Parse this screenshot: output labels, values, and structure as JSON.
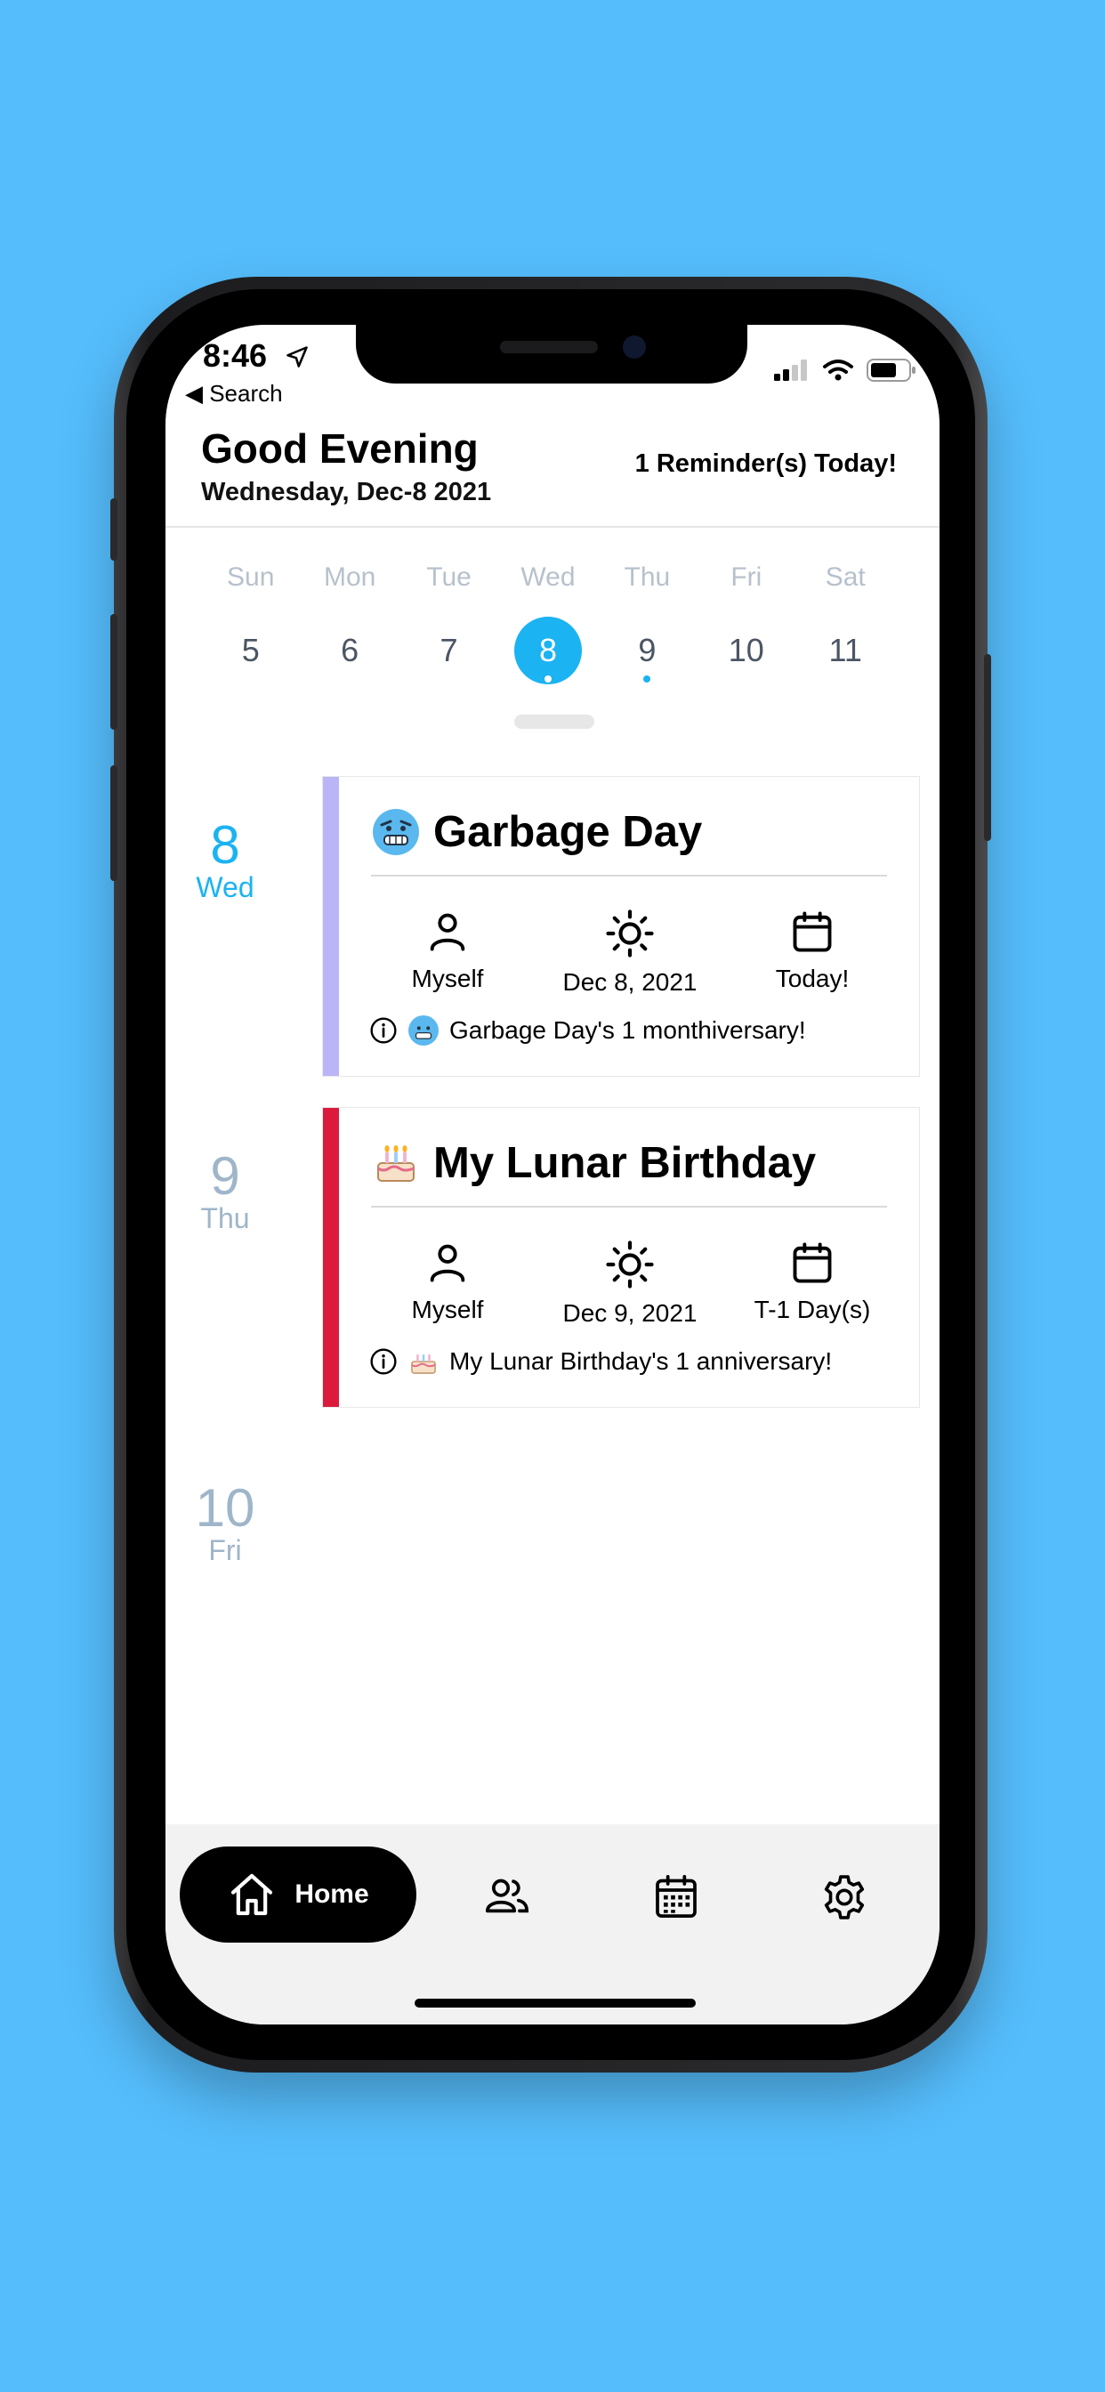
{
  "status_bar": {
    "time": "8:46",
    "back_label": "◀ Search"
  },
  "header": {
    "greeting": "Good Evening",
    "date": "Wednesday, Dec-8 2021",
    "reminder_count": "1 Reminder(s) Today!"
  },
  "week": {
    "days": [
      {
        "dow": "Sun",
        "num": "5"
      },
      {
        "dow": "Mon",
        "num": "6"
      },
      {
        "dow": "Tue",
        "num": "7"
      },
      {
        "dow": "Wed",
        "num": "8",
        "selected": true,
        "has_event": true
      },
      {
        "dow": "Thu",
        "num": "9",
        "has_event": true
      },
      {
        "dow": "Fri",
        "num": "10"
      },
      {
        "dow": "Sat",
        "num": "11"
      }
    ]
  },
  "timeline": [
    {
      "num": "8",
      "dow": "Wed",
      "color": "#1bb3f2"
    },
    {
      "num": "9",
      "dow": "Thu",
      "color": "#9fb5c9"
    },
    {
      "num": "10",
      "dow": "Fri",
      "color": "#9fb5c9"
    }
  ],
  "events": [
    {
      "title": "Garbage Day",
      "icon": "cold-face-emoji",
      "bar_color": "#b9b5f7",
      "who": "Myself",
      "date": "Dec 8, 2021",
      "countdown": "Today!",
      "note": "Garbage Day's 1 monthiversary!"
    },
    {
      "title": "My Lunar Birthday",
      "icon": "birthday-cake-emoji",
      "bar_color": "#dc1b3c",
      "who": "Myself",
      "date": "Dec 9, 2021",
      "countdown": "T-1 Day(s)",
      "note": "My Lunar Birthday's 1 anniversary!"
    }
  ],
  "tabbar": {
    "home_label": "Home",
    "tabs": [
      "home-icon",
      "people-icon",
      "calendar-icon",
      "gear-icon"
    ]
  },
  "colors": {
    "background": "#55bdfc",
    "accent": "#1bb3f2"
  }
}
